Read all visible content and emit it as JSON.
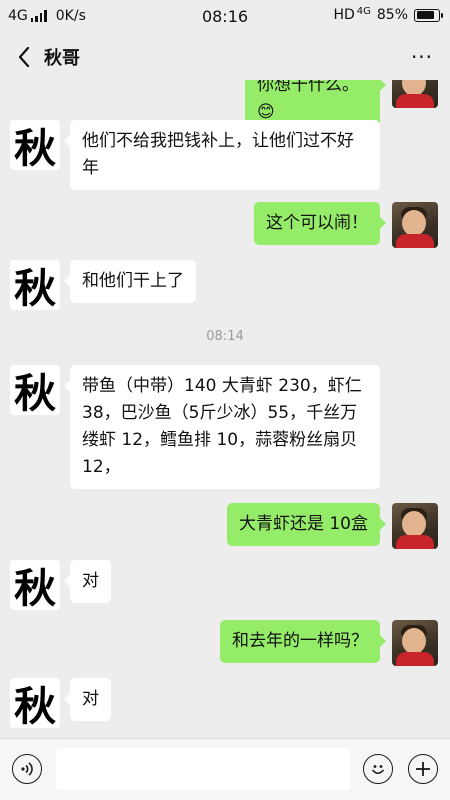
{
  "status_bar": {
    "network": "4G",
    "speed": "0K/s",
    "time": "08:16",
    "hd": "HD",
    "hd_network": "4G",
    "battery": "85%",
    "battery_level": 0.85
  },
  "header": {
    "title": "秋哥",
    "back_icon": "chevron-left-icon",
    "more_icon": "more-dots-icon",
    "more_label": "···"
  },
  "contact_avatar_text": "秋",
  "messages": [
    {
      "from": "me",
      "text": "你想干什么。😊"
    },
    {
      "from": "contact",
      "text": "他们不给我把钱补上，让他们过不好年"
    },
    {
      "from": "me",
      "text": "这个可以闹！"
    },
    {
      "from": "contact",
      "text": "和他们干上了"
    },
    {
      "timestamp": "08:14"
    },
    {
      "from": "contact",
      "text": "带鱼（中带）140 大青虾 230，虾仁 38，巴沙鱼（5斤少冰）55，千丝万缕虾 12，鳕鱼排 10，蒜蓉粉丝扇贝 12，"
    },
    {
      "from": "me",
      "text": "大青虾还是 10盒"
    },
    {
      "from": "contact",
      "text": "对"
    },
    {
      "from": "me",
      "text": "和去年的一样吗？"
    },
    {
      "from": "contact",
      "text": "对"
    }
  ],
  "input_bar": {
    "voice_icon": "voice-icon",
    "emoji_icon": "emoji-icon",
    "add_icon": "plus-icon",
    "input_value": ""
  }
}
